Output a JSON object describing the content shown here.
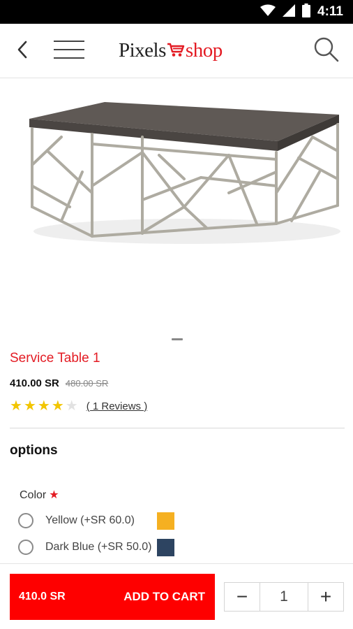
{
  "status_bar": {
    "time": "4:11",
    "icons": [
      "wifi-icon",
      "signal-icon",
      "battery-icon"
    ]
  },
  "header": {
    "logo": {
      "part1": "Pixels",
      "cart_icon": "cart-icon",
      "part2": "shop"
    },
    "icons": {
      "back": "back-arrow-icon",
      "menu": "hamburger-menu-icon",
      "search": "search-icon"
    }
  },
  "product": {
    "image": "metal frame coffee table image",
    "title": "Service Table 1",
    "price": "410.00 SR",
    "old_price": "480.00 SR",
    "rating": 4,
    "rating_max": 5,
    "reviews_link": "( 1 Reviews )"
  },
  "options": {
    "heading": "options",
    "color_label": "Color",
    "required_mark": "★",
    "colors": [
      {
        "label": "Yellow (+SR 60.0)",
        "swatch": "#f5b021"
      },
      {
        "label": "Dark Blue (+SR 50.0)",
        "swatch": "#2d4461"
      }
    ]
  },
  "cart_bar": {
    "price": "410.0 SR",
    "button_label": "ADD TO CART",
    "quantity": "1",
    "minus": "−",
    "plus": "+"
  },
  "colors": {
    "accent": "#e31b23",
    "cart_button": "#fe0000",
    "star": "#f2c500"
  }
}
